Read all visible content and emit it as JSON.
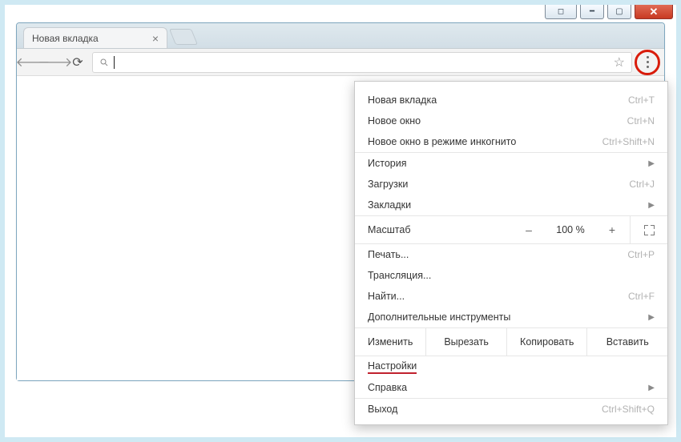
{
  "window": {
    "controls": [
      "user",
      "minimize",
      "maximize",
      "close"
    ]
  },
  "tab": {
    "title": "Новая вкладка"
  },
  "omnibox": {
    "value": "",
    "placeholder": ""
  },
  "menu": {
    "section1": [
      {
        "label": "Новая вкладка",
        "shortcut": "Ctrl+T"
      },
      {
        "label": "Новое окно",
        "shortcut": "Ctrl+N"
      },
      {
        "label": "Новое окно в режиме инкогнито",
        "shortcut": "Ctrl+Shift+N"
      }
    ],
    "section2": [
      {
        "label": "История",
        "submenu": true
      },
      {
        "label": "Загрузки",
        "shortcut": "Ctrl+J"
      },
      {
        "label": "Закладки",
        "submenu": true
      }
    ],
    "zoom": {
      "label": "Масштаб",
      "minus": "–",
      "value": "100 %",
      "plus": "+"
    },
    "section3": [
      {
        "label": "Печать...",
        "shortcut": "Ctrl+P"
      },
      {
        "label": "Трансляция..."
      },
      {
        "label": "Найти...",
        "shortcut": "Ctrl+F"
      },
      {
        "label": "Дополнительные инструменты",
        "submenu": true
      }
    ],
    "edit": {
      "label": "Изменить",
      "cut": "Вырезать",
      "copy": "Копировать",
      "paste": "Вставить"
    },
    "section4": [
      {
        "label": "Настройки",
        "highlight": true
      },
      {
        "label": "Справка",
        "submenu": true
      }
    ],
    "section5": [
      {
        "label": "Выход",
        "shortcut": "Ctrl+Shift+Q"
      }
    ]
  }
}
